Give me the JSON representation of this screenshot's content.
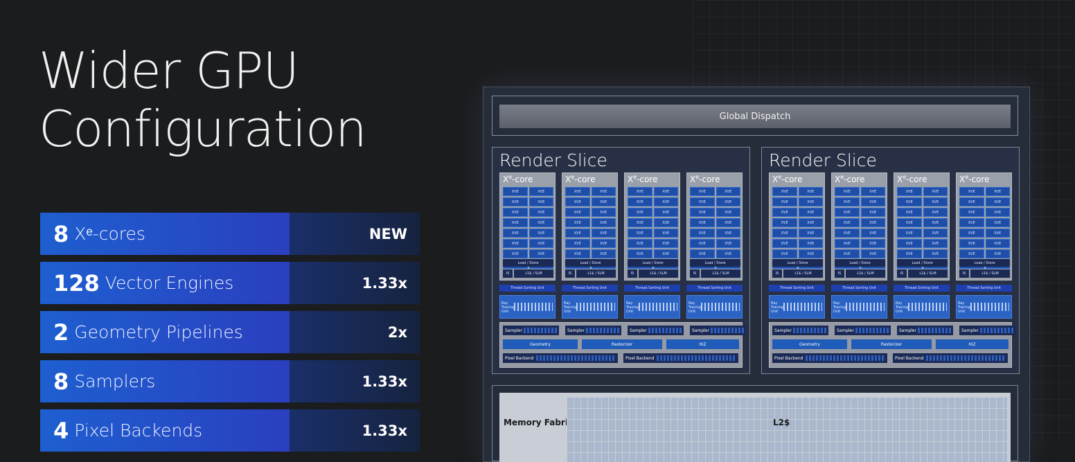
{
  "title": {
    "line1": "Wider GPU",
    "line2": "Configuration"
  },
  "stats": [
    {
      "number": "8",
      "label": "Xᵉ-cores",
      "change": "NEW"
    },
    {
      "number": "128",
      "label": "Vector Engines",
      "change": "1.33x"
    },
    {
      "number": "2",
      "label": "Geometry Pipelines",
      "change": "2x"
    },
    {
      "number": "8",
      "label": "Samplers",
      "change": "1.33x"
    },
    {
      "number": "4",
      "label": "Pixel Backends",
      "change": "1.33x"
    }
  ],
  "diagram": {
    "global_dispatch": "Global Dispatch",
    "render_slice_title": "Render Slice",
    "xe_core_label": "X",
    "xe_core_sup": "e",
    "xe_core_suffix": "-core",
    "xve_label": "XVE",
    "load_store": "Load / Store",
    "is_label": "IS",
    "slm_label": "L1$ / SLM",
    "thread_sorting_unit": "Thread Sorting Unit",
    "ray_tracing_unit": "Ray Tracing Unit",
    "sampler": "Sampler",
    "geometry": "Geometry",
    "rasterizer": "Rasterizer",
    "hiz": "HiZ",
    "pixel_backend": "Pixel Backend",
    "memory_fabric": "Memory Fabric",
    "l2": "L2$"
  },
  "colors": {
    "background": "#1b1c1e",
    "stat_blue": "#1e5fd0",
    "stat_dark": "#16233f",
    "xve_blue": "#1f4ea8"
  }
}
